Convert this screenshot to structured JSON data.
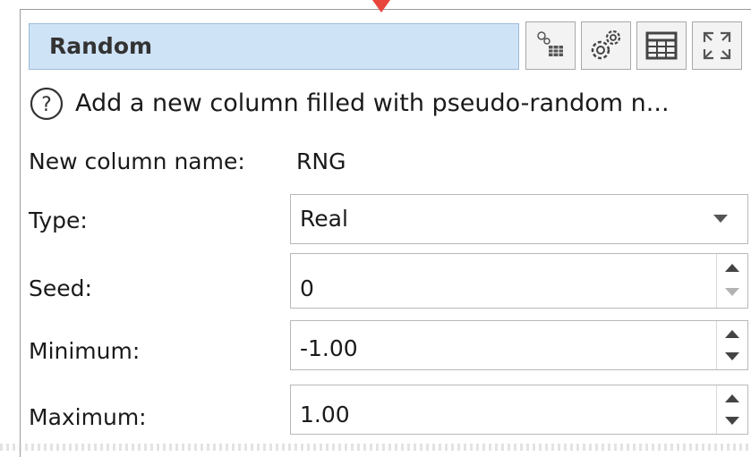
{
  "colors": {
    "title_bg": "#cfe3f7",
    "pointer": "#e8453c",
    "field_border": "#b9b9b9"
  },
  "panel": {
    "title": "Random",
    "toolbar": [
      {
        "icon": "node-settings-icon"
      },
      {
        "icon": "gears-icon"
      },
      {
        "icon": "table-icon"
      },
      {
        "icon": "maximize-icon"
      }
    ]
  },
  "description": {
    "icon": "help-icon",
    "text": "Add a new column filled with pseudo-random n..."
  },
  "form": {
    "new_column_name": {
      "label": "New column name:",
      "value": "RNG"
    },
    "type": {
      "label": "Type:",
      "value": "Real"
    },
    "seed": {
      "label": "Seed:",
      "value": "0"
    },
    "minimum": {
      "label": "Minimum:",
      "value": "-1.00"
    },
    "maximum": {
      "label": "Maximum:",
      "value": "1.00"
    }
  }
}
